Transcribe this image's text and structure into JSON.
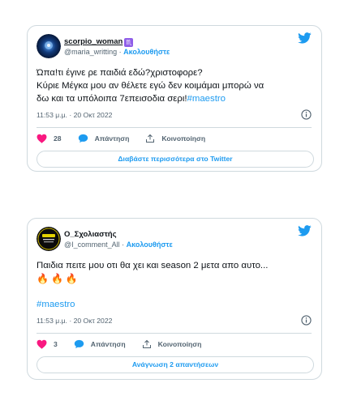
{
  "tweets": [
    {
      "display_name": "scorpio_woman",
      "badge": "♏",
      "handle": "@maria_writting",
      "separator": " · ",
      "follow_label": "Ακολουθήστε",
      "text_line1": "Ώπα!τι έγινε ρε παιδιά εδώ?χριστοφορε?",
      "text_line2": "Κύριε Μέγκα μου αν θέλετε εγώ δεν κοιμάμαι μπορώ να",
      "text_line3": "δω και τα υπόλοιπα 7επεισοδια σερι!",
      "hashtag": "#maestro",
      "timestamp": "11:53 μ.μ. · 20 Οκτ 2022",
      "likes": "28",
      "reply_label": "Απάντηση",
      "share_label": "Κοινοποίηση",
      "button_label": "Διαβάστε περισσότερα στο Twitter"
    },
    {
      "display_name": "Ο_Σχολιαστής",
      "handle": "@I_comment_All",
      "separator": " · ",
      "follow_label": "Ακολουθήστε",
      "avatar_text": "Ο Σχολιαστής",
      "text_line1": "Παιδια πειτε μου οτι θα χει και season 2 μετα απο αυτο...",
      "emojis": [
        "🔥",
        "🔥",
        "🔥"
      ],
      "hashtag": "#maestro",
      "timestamp": "11:53 μ.μ. · 20 Οκτ 2022",
      "likes": "3",
      "reply_label": "Απάντηση",
      "share_label": "Κοινοποίηση",
      "button_label": "Ανάγνωση 2 απαντήσεων"
    }
  ],
  "colors": {
    "brand_blue": "#1d9bf0",
    "heart_pink": "#f91880",
    "muted_text": "#536471",
    "border": "#cfd9de"
  }
}
